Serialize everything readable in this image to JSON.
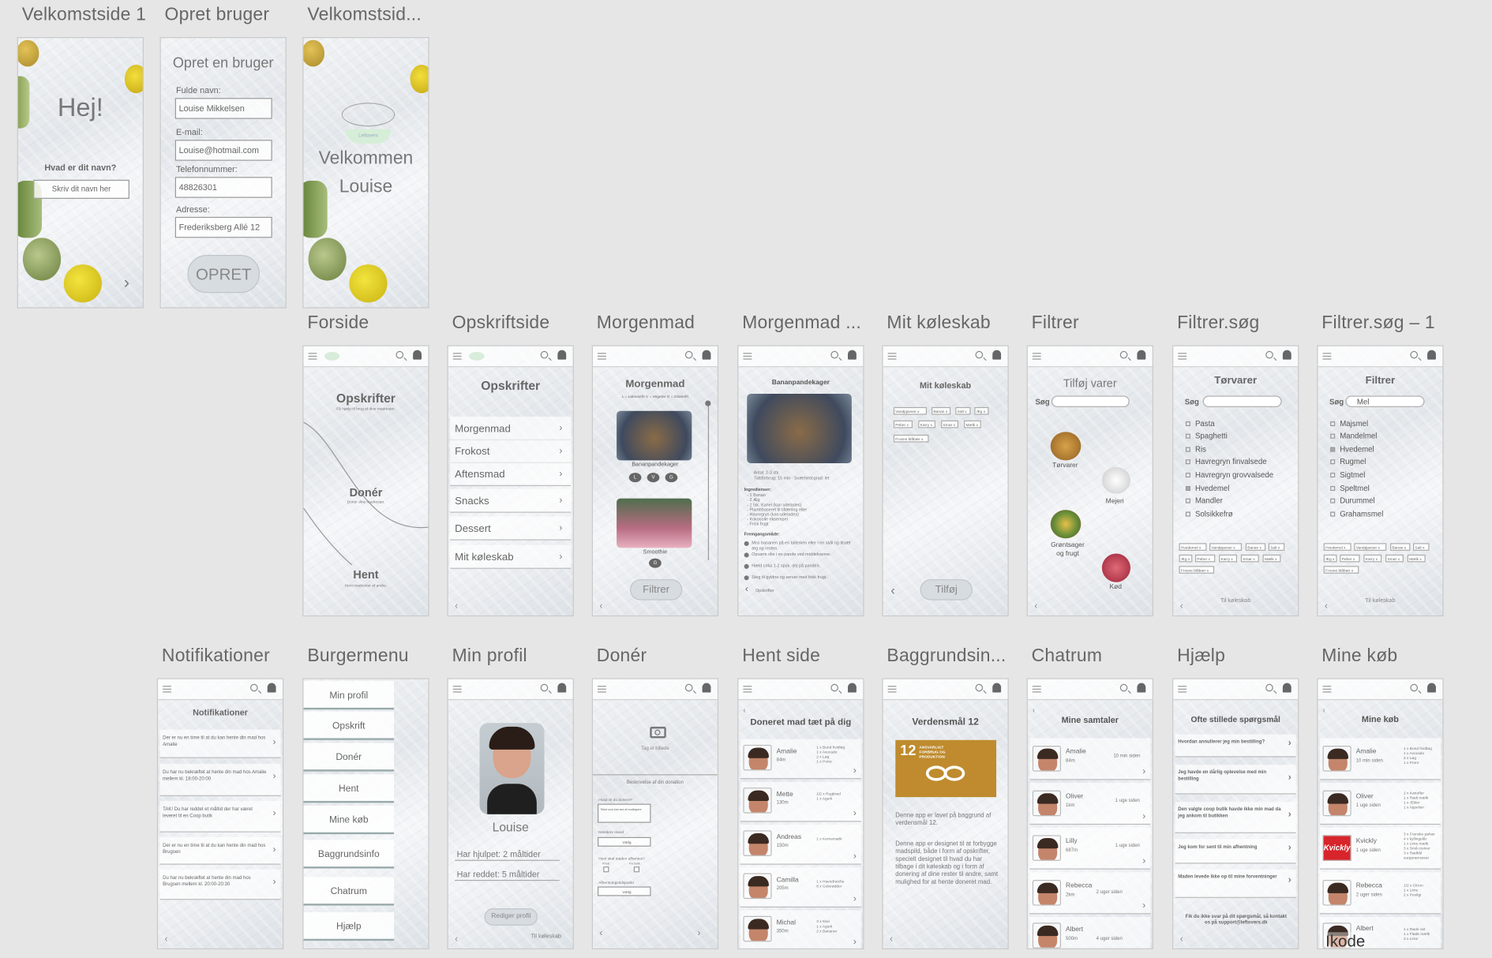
{
  "labels": [
    "Velkomstside 1",
    "Opret bruger",
    "Velkomstsid...",
    "Forside",
    "Opskriftside",
    "Morgenmad",
    "Morgenmad ...",
    "Mit køleskab",
    "Filtrer",
    "Filtrer.søg",
    "Filtrer.søg – 1",
    "Notifikationer",
    "Burgermenu",
    "Min profil",
    "Donér",
    "Hent side",
    "Baggrundsin...",
    "Chatrum",
    "Hjælp",
    "Mine køb"
  ],
  "welcome1": {
    "title": "Hej!",
    "question": "Hvad er dit navn?",
    "placeholder": "Skriv dit navn her",
    "next": "›"
  },
  "create": {
    "title": "Opret en bruger",
    "name_label": "Fulde navn:",
    "name": "Louise Mikkelsen",
    "email_label": "E-mail:",
    "email": "Louise@hotmail.com",
    "phone_label": "Telefonnummer:",
    "phone": "48826301",
    "addr_label": "Adresse:",
    "addr": "Frederiksberg Allé 12",
    "button": "OPRET"
  },
  "welcome2": {
    "logo": "Leftovers",
    "line1": "Velkommen",
    "line2": "Louise"
  },
  "front": {
    "s1": "Opskrifter",
    "s1sub": "Få hjælp til brug af dine madrester.",
    "s2": "Donér",
    "s2sub": "Donér dine madrester.",
    "s3": "Hent",
    "s3sub": "Hent madrester af andre."
  },
  "recipes": {
    "title": "Opskrifter",
    "items": [
      "Morgenmad",
      "Frokost",
      "Aftensmad",
      "Snacks",
      "Dessert",
      "Mit køleskab"
    ]
  },
  "breakfast": {
    "title": "Morgenmad",
    "legend": "L = Laktosefri   V = Vegetar   G = Glutenfri",
    "r1": "Bananpandekager",
    "r1tags": [
      "L",
      "V",
      "G"
    ],
    "r2": "Smoothie",
    "r2tags": [
      "G"
    ],
    "button": "Filtrer"
  },
  "recipe": {
    "title": "Bananpandekager",
    "meta1": "Antal: 2-3 stk.",
    "meta2": "Tidsforbrug: 15 min · Sværhedsgrad: let",
    "ing_title": "Ingredienser:",
    "ingredients": [
      "- 1 Banan",
      "- 2 Æg",
      "- 1 tsk. Kanel (kan udelades)",
      "- Plantebaseret til tiltæning eller",
      "- Havregryn (kan udelades)",
      "- Kokosolie eksempel",
      "- Frisk frugt"
    ],
    "step_title": "Fremgangsmåde:",
    "steps": [
      "Mos bananen på en tallerken eller i en skål og tilsæt æg og resten.",
      "Opvarm olie i en pande ved middelvarme.",
      "Hæld cirka 1-2 spsk. dej på panden.",
      "Steg til gyldne og server med frisk frugt."
    ],
    "back": "Opskrifter"
  },
  "fridge": {
    "title": "Mit køleskab",
    "tags": [
      "Vandpjavser x",
      "Banan x",
      "Salt x",
      "Æg x",
      "Peber x",
      "Karry x",
      "Smør x",
      "Mælk x",
      "Frosne blåbær x"
    ],
    "button": "Tilføj"
  },
  "filter": {
    "title": "Tilføj varer",
    "search": "Søg",
    "cats": [
      "Tørvarer",
      "Mejeri",
      "Grøntsager og frugt",
      "Kød"
    ]
  },
  "filter_search": {
    "title": "Tørvarer",
    "search": "Søg",
    "items": [
      "Pasta",
      "Spaghetti",
      "Ris",
      "Havregryn finvalsede",
      "Havregryn grovvalsede",
      "Hvedemel",
      "Mandler",
      "Solsikkefrø"
    ],
    "checked": 5,
    "tags": [
      "Hvedemel x",
      "Vandpjavser x",
      "Banan x",
      "Salt x",
      "Æg x",
      "Peber x",
      "Karry x",
      "Smør x",
      "Mælk x",
      "Frosne blåbær x"
    ],
    "link": "Til køleskab"
  },
  "filter_search2": {
    "title": "Filtrer",
    "search": "Søg",
    "query": "Mel",
    "items": [
      "Majsmel",
      "Mandelmel",
      "Hvedemel",
      "Rugmel",
      "Sigtmel",
      "Speltmel",
      "Durummel",
      "Grahamsmel"
    ],
    "checked": 2,
    "tags": [
      "Hvedemel x",
      "Vandpjavser x",
      "Banan x",
      "Salt x",
      "Æg x",
      "Peber x",
      "Karry x",
      "Smør x",
      "Mælk x",
      "Frosne blåbær x"
    ],
    "link": "Til køleskab"
  },
  "notifications": {
    "title": "Notifikationer",
    "items": [
      "Der er nu en time til at du kan hente din mad hos Amalie",
      "Du har nu bekræftet at hente din mad hos Amalie mellem kl. 18:00-20:00",
      "TAK! Du  har reddet et måltid der har været leveret til en Coop butik",
      "Der er nu en time til at du kan hente din mad hos Brugsen",
      "Du har nu bekræftet at hente din mad hos Brugsen mellem kl. 20:00-20:30"
    ]
  },
  "burger": {
    "items": [
      "Min profil",
      "Opskrift",
      "Donér",
      "Hent",
      "Mine køb",
      "Baggrundsinfo",
      "Chatrum",
      "Hjælp"
    ]
  },
  "profile": {
    "name": "Louise",
    "helped": "Har hjulpet: 2 måltider",
    "saved": "Har reddet: 5 måltider",
    "button": "Rediger profil",
    "link": "Til køleskab"
  },
  "donate": {
    "photo": "Tag et billede",
    "desc": "Beskrivelse af din donation",
    "what": "Hvad vil du donere?",
    "what_ph": "Tekst som kan ses af modtagere",
    "amount": "Mælders stand",
    "amount_sel": "Vælg",
    "how": "Hvor skal maden afhentes?",
    "opt1": "Privat",
    "opt2": "Fra butik",
    "time": "Afhentningstidspunkt",
    "time_sel": "Vælg"
  },
  "pickup": {
    "title": "Doneret mad tæt på dig",
    "people": [
      {
        "name": "Amalie",
        "dist": "84m",
        "items": "1 x Bund hvidløg\n1 x Avocado\n2 x Løg\n1 x Porre"
      },
      {
        "name": "Mette",
        "dist": "130m",
        "items": "1/2 x Rugbrød\n1 x Agurk"
      },
      {
        "name": "Andreas",
        "dist": "150m",
        "items": "1 x Kernemælk"
      },
      {
        "name": "Camilla",
        "dist": "205m",
        "items": "1 x Havrefraiche\n8 x Gulerødder"
      },
      {
        "name": "Michal",
        "dist": "350m",
        "items": "3 x Kiwi\n1 x Agurk\n2 x Bananer"
      }
    ]
  },
  "background": {
    "title": "Verdensmål 12",
    "sdg_num": "12",
    "sdg_text": "ANSVARLIGT FORBRUG OG PRODUKTION",
    "p1": "Denne app er lavet på baggrund af verdensmål 12.",
    "p2": "Denne app er designet til at forbygge madspild, både i form af opskrifter, specielt designet til hvad du har tilbage i dit køleskab og i form af donering af dine rester til andre, samt mulighed for at hente doneret mad."
  },
  "chat": {
    "title": "Mine samtaler",
    "people": [
      {
        "name": "Amalie",
        "dist": "84m",
        "time": "10 min siden"
      },
      {
        "name": "Oliver",
        "dist": "1km",
        "time": "1 uge siden"
      },
      {
        "name": "Lilly",
        "dist": "687m",
        "time": "1 uge siden"
      },
      {
        "name": "Rebecca",
        "dist": "2km",
        "time": "2 uger siden"
      },
      {
        "name": "Albert",
        "dist": "500m",
        "time": "4 uger siden"
      }
    ]
  },
  "help": {
    "title": "Ofte stillede spørgsmål",
    "items": [
      "Hvordan annullerer jeg min bestilling?",
      "Jeg havde en dårlig oplevelse med min bestilling",
      "Den valgte coop butik havde ikke min mad da jeg ankom til butikken",
      "Jeg kom for sent til min afhentning",
      "Maden levede ikke op til mine forventninger"
    ],
    "footer": "Fik du ikke svar på dit spørgsmål, så kontakt os på support@leftovers.dk"
  },
  "purchases": {
    "title": "Mine køb",
    "people": [
      {
        "name": "Amalie",
        "time": "10 min siden",
        "items": "1 x Bund hvidløg\n1 x Avocado\n2 x Løg\n1 x Porre"
      },
      {
        "name": "Oliver",
        "time": "1 uge siden",
        "items": "2 x Kartofler\n1 x Rødt mælk\n1 x Æbler\n1 x Appelsin"
      },
      {
        "name": "Kvickly",
        "time": "1 uge siden",
        "items": "3 x Franske pølser\n4 x kyllingelår\n1 x Lime mælk\n3 x Små rosiner\n3 x Rødkål\nsurpprænssser"
      },
      {
        "name": "Rebecca",
        "time": "2 uger siden",
        "items": "1/2 x Citron\n1 x Lime\n2 x Peoligi"
      },
      {
        "name": "Albert",
        "time": "",
        "items": "1 x Røde ost\n1 x Fløde mælk\n2 x Lime"
      }
    ],
    "kvickly": "Kvickly",
    "overlay": "Ikode"
  }
}
